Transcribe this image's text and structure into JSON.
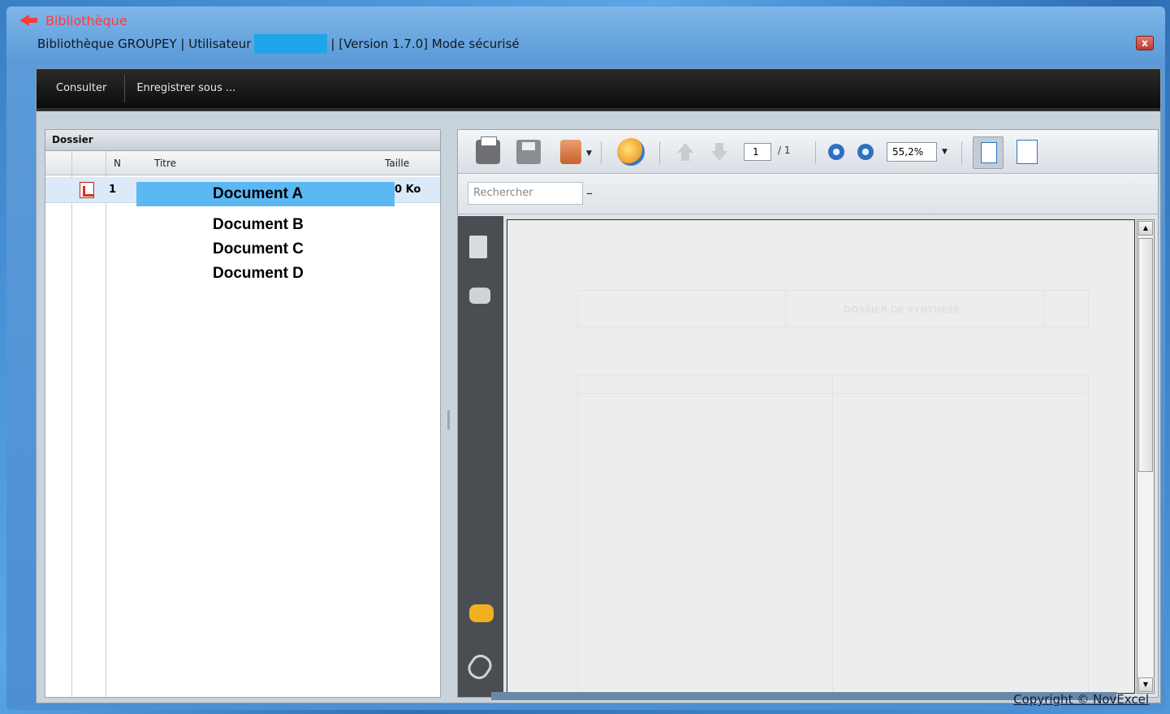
{
  "window": {
    "app_title": "Bibliothèque",
    "subtitle_prefix": "Bibliothèque GROUPEY | Utilisateur",
    "subtitle_suffix": "| [Version 1.7.0]  Mode sécurisé",
    "close_label": "x"
  },
  "menu": {
    "items": [
      "Consulter",
      "Enregistrer sous ..."
    ]
  },
  "dossier": {
    "title": "Dossier",
    "columns": [
      "N",
      "Titre",
      "Taille"
    ],
    "selected_row": {
      "num": "1",
      "size": "0 Ko"
    },
    "documents": [
      "Document A",
      "Document B",
      "Document C",
      "Document D"
    ]
  },
  "viewer": {
    "page_current": "1",
    "page_separator": "/ 1",
    "zoom_value": "55,2%",
    "search_placeholder": "Rechercher",
    "search_dash": "–",
    "doc_title_faded": "DOSSIER DE SYNTHESE"
  },
  "footer": {
    "copyright": "Copyright © NovExcel"
  }
}
